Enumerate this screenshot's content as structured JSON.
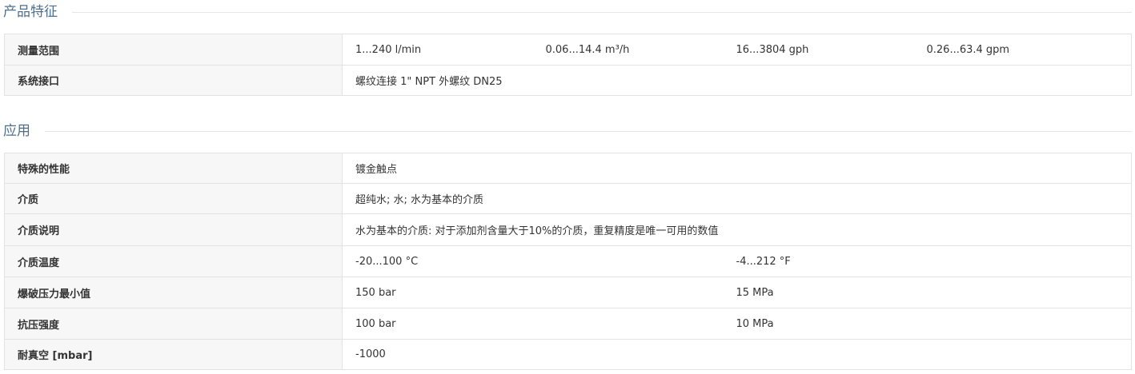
{
  "features": {
    "title": "产品特征",
    "rows": [
      {
        "label": "测量范围",
        "values": [
          "1...240 l/min",
          "0.06...14.4 m³/h",
          "16...3804 gph",
          "0.26...63.4 gpm"
        ]
      },
      {
        "label": "系统接口",
        "values": [
          "螺纹连接 1\" NPT 外螺纹 DN25"
        ]
      }
    ]
  },
  "application": {
    "title": "应用",
    "rows": [
      {
        "label": "特殊的性能",
        "values": [
          "镀金触点"
        ]
      },
      {
        "label": "介质",
        "values": [
          "超纯水; 水; 水为基本的介质"
        ]
      },
      {
        "label": "介质说明",
        "values": [
          "水为基本的介质: 对于添加剂含量大于10%的介质，重复精度是唯一可用的数值"
        ]
      },
      {
        "label": "介质温度",
        "values": [
          "-20...100 °C",
          "-4...212 °F"
        ]
      },
      {
        "label": "爆破压力最小值",
        "values": [
          "150 bar",
          "15 MPa"
        ]
      },
      {
        "label": "抗压强度",
        "values": [
          "100 bar",
          "10 MPa"
        ]
      },
      {
        "label": "耐真空 [mbar]",
        "values": [
          "-1000"
        ]
      }
    ]
  }
}
